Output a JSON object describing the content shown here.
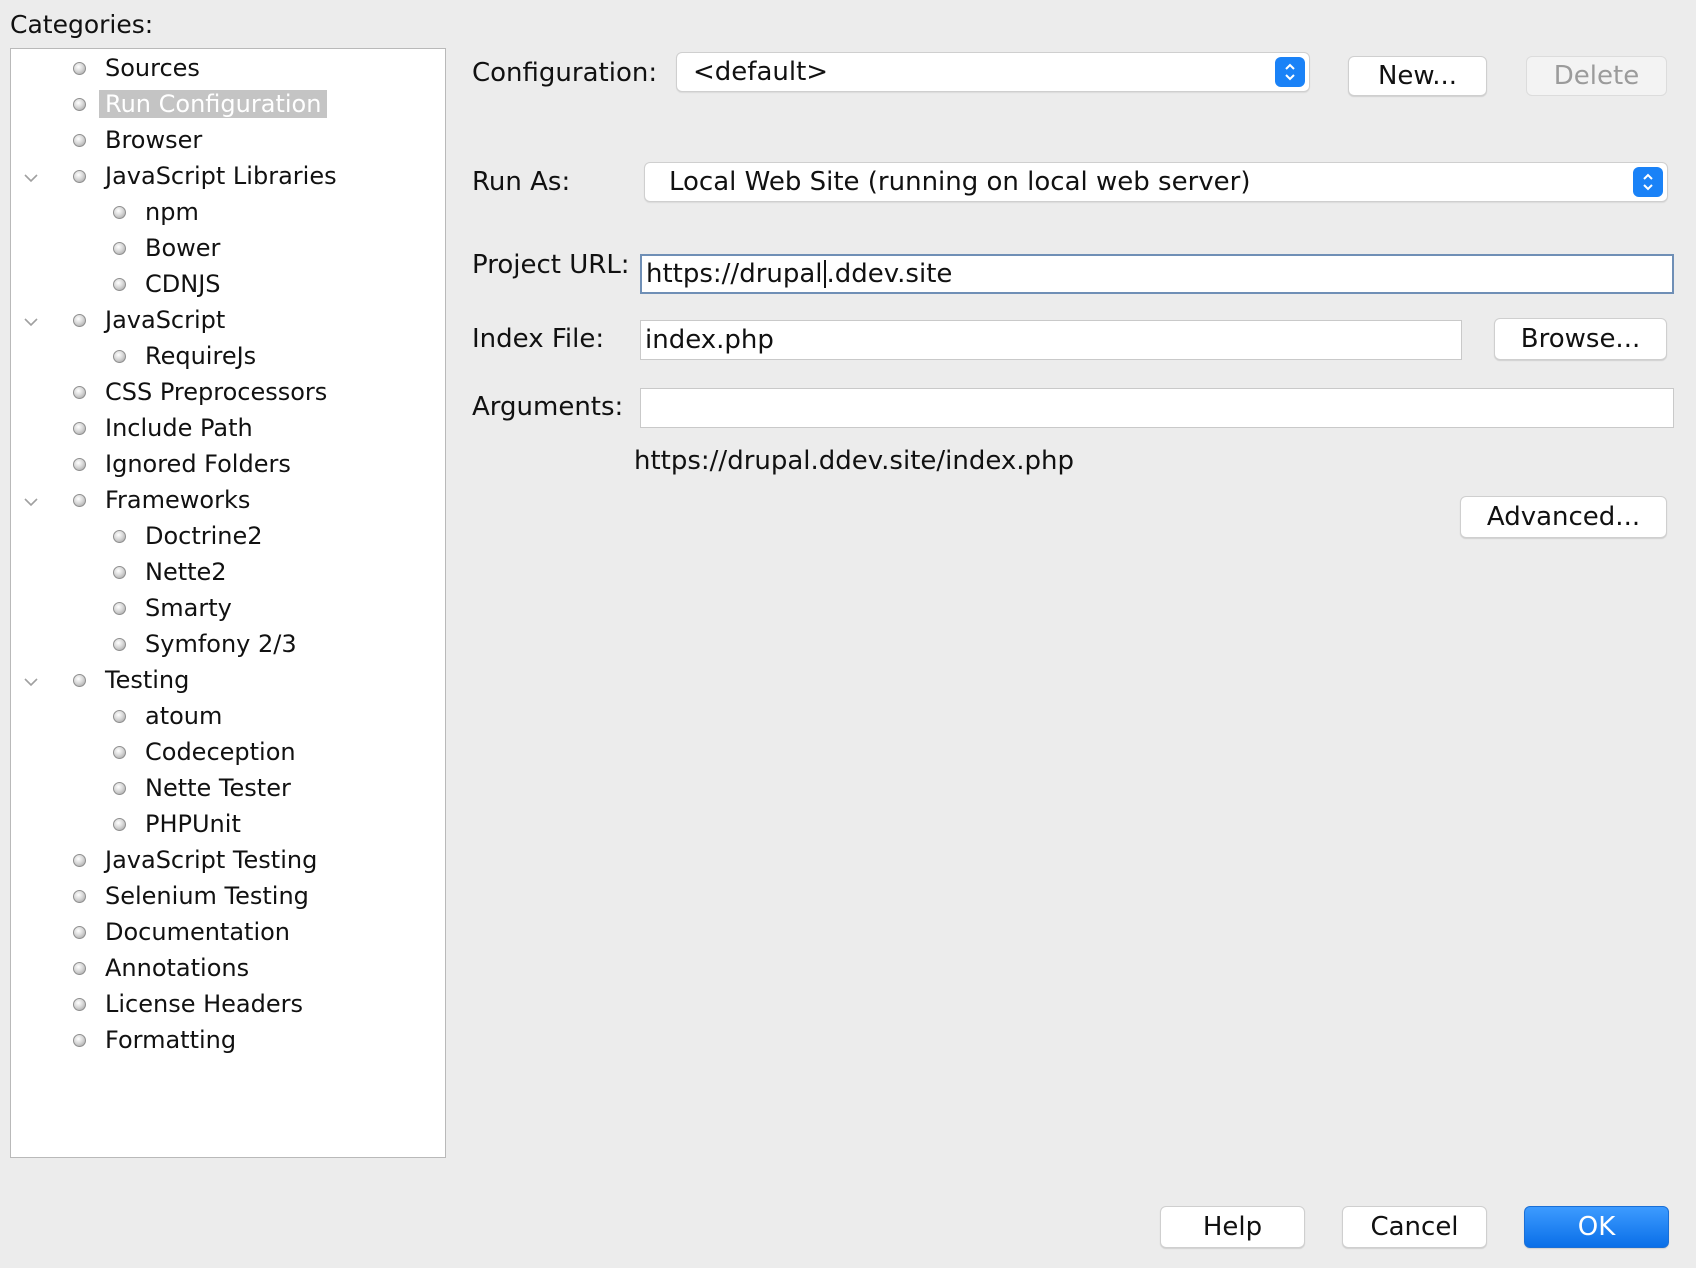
{
  "categories_label": "Categories:",
  "tree": [
    {
      "label": "Sources",
      "level": 0,
      "expandable": false,
      "selected": false
    },
    {
      "label": "Run Configuration",
      "level": 0,
      "expandable": false,
      "selected": true
    },
    {
      "label": "Browser",
      "level": 0,
      "expandable": false,
      "selected": false
    },
    {
      "label": "JavaScript Libraries",
      "level": 0,
      "expandable": true,
      "selected": false
    },
    {
      "label": "npm",
      "level": 1,
      "expandable": false,
      "selected": false
    },
    {
      "label": "Bower",
      "level": 1,
      "expandable": false,
      "selected": false
    },
    {
      "label": "CDNJS",
      "level": 1,
      "expandable": false,
      "selected": false
    },
    {
      "label": "JavaScript",
      "level": 0,
      "expandable": true,
      "selected": false
    },
    {
      "label": "RequireJs",
      "level": 1,
      "expandable": false,
      "selected": false
    },
    {
      "label": "CSS Preprocessors",
      "level": 0,
      "expandable": false,
      "selected": false
    },
    {
      "label": "Include Path",
      "level": 0,
      "expandable": false,
      "selected": false
    },
    {
      "label": "Ignored Folders",
      "level": 0,
      "expandable": false,
      "selected": false
    },
    {
      "label": "Frameworks",
      "level": 0,
      "expandable": true,
      "selected": false
    },
    {
      "label": "Doctrine2",
      "level": 1,
      "expandable": false,
      "selected": false
    },
    {
      "label": "Nette2",
      "level": 1,
      "expandable": false,
      "selected": false
    },
    {
      "label": "Smarty",
      "level": 1,
      "expandable": false,
      "selected": false
    },
    {
      "label": "Symfony 2/3",
      "level": 1,
      "expandable": false,
      "selected": false
    },
    {
      "label": "Testing",
      "level": 0,
      "expandable": true,
      "selected": false
    },
    {
      "label": "atoum",
      "level": 1,
      "expandable": false,
      "selected": false
    },
    {
      "label": "Codeception",
      "level": 1,
      "expandable": false,
      "selected": false
    },
    {
      "label": "Nette Tester",
      "level": 1,
      "expandable": false,
      "selected": false
    },
    {
      "label": "PHPUnit",
      "level": 1,
      "expandable": false,
      "selected": false
    },
    {
      "label": "JavaScript Testing",
      "level": 0,
      "expandable": false,
      "selected": false
    },
    {
      "label": "Selenium Testing",
      "level": 0,
      "expandable": false,
      "selected": false
    },
    {
      "label": "Documentation",
      "level": 0,
      "expandable": false,
      "selected": false
    },
    {
      "label": "Annotations",
      "level": 0,
      "expandable": false,
      "selected": false
    },
    {
      "label": "License Headers",
      "level": 0,
      "expandable": false,
      "selected": false
    },
    {
      "label": "Formatting",
      "level": 0,
      "expandable": false,
      "selected": false
    }
  ],
  "form": {
    "configuration_label": "Configuration:",
    "configuration_value": "<default>",
    "new_button": "New...",
    "delete_button": "Delete",
    "run_as_label": "Run As:",
    "run_as_value": "Local Web Site (running on local web server)",
    "project_url_label": "Project URL:",
    "project_url_before_caret": "https://drupal",
    "project_url_after_caret": ".ddev.site",
    "index_file_label": "Index File:",
    "index_file_value": "index.php",
    "browse_button": "Browse...",
    "arguments_label": "Arguments:",
    "arguments_value": "",
    "url_preview": "https://drupal.ddev.site/index.php",
    "advanced_button": "Advanced..."
  },
  "footer": {
    "help_button": "Help",
    "cancel_button": "Cancel",
    "ok_button": "OK"
  },
  "colors": {
    "accent": "#1a82f7",
    "selection": "#c4c4c4",
    "background": "#ececec"
  }
}
